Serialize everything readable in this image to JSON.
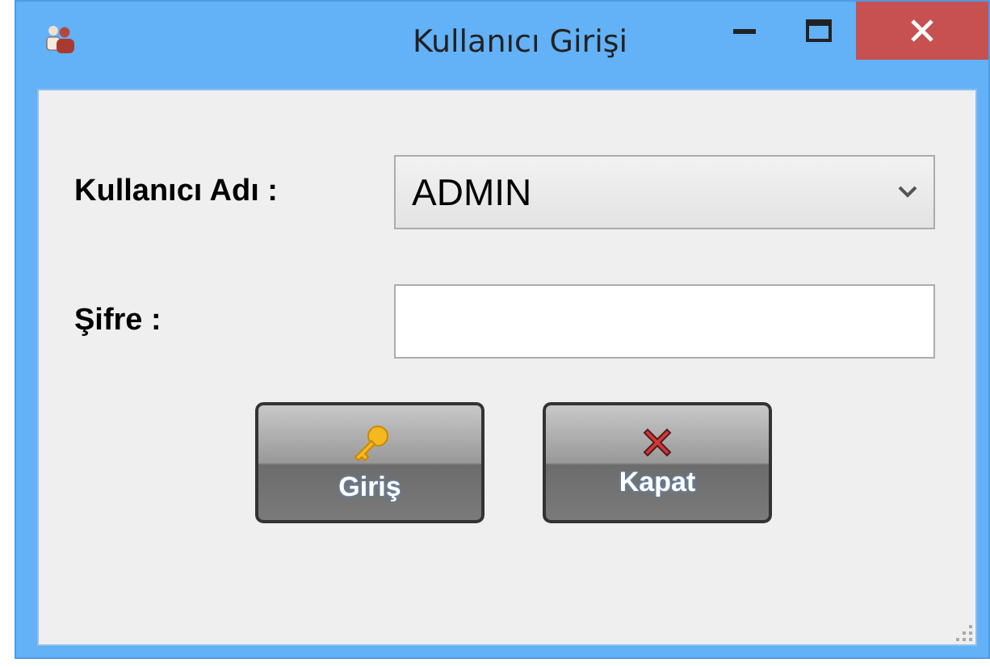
{
  "window": {
    "title": "Kullanıcı Girişi"
  },
  "form": {
    "username_label": "Kullanıcı Adı :",
    "username_value": "ADMIN",
    "password_label": "Şifre :"
  },
  "buttons": [
    {
      "kind": "login",
      "label": "Giriş"
    },
    {
      "kind": "close",
      "label": "Kapat"
    }
  ]
}
